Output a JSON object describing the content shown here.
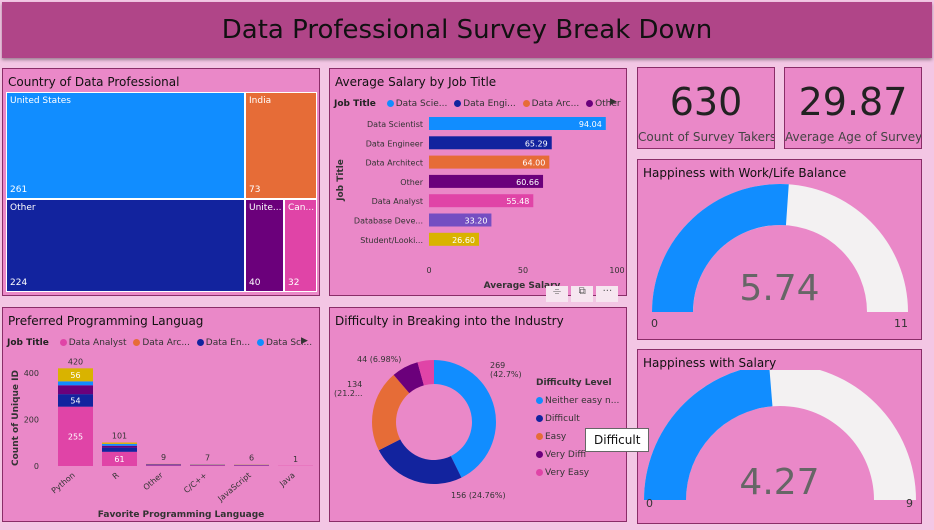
{
  "title": "Data Professional Survey Break Down",
  "country": {
    "title": "Country of Data Professional",
    "cells": [
      {
        "label": "United States",
        "value": "261",
        "color": "#118dff"
      },
      {
        "label": "India",
        "value": "73",
        "color": "#e66c37"
      },
      {
        "label": "Other",
        "value": "224",
        "color": "#12239e"
      },
      {
        "label": "Unite...",
        "value": "40",
        "color": "#6b007b"
      },
      {
        "label": "Can...",
        "value": "32",
        "color": "#e044a7"
      }
    ]
  },
  "salary": {
    "title": "Average Salary by Job Title",
    "legend_title": "Job Title",
    "legend": [
      "Data Scie...",
      "Data Engi...",
      "Data Arc...",
      "Other"
    ],
    "legend_colors": [
      "#118dff",
      "#12239e",
      "#e66c37",
      "#6b007b"
    ],
    "ylabel": "Job Title",
    "xlabel": "Average Salary",
    "ticks": [
      "0",
      "50",
      "100"
    ]
  },
  "kpi1": {
    "value": "630",
    "label": "Count of Survey Takers"
  },
  "kpi2": {
    "value": "29.87",
    "label": "Average Age of Survey ..."
  },
  "gauge1": {
    "title": "Happiness with Work/Life Balance",
    "value_label": "5.74",
    "min": "0",
    "max": "11",
    "value": 5.74,
    "maxv": 11
  },
  "gauge2": {
    "title": "Happiness with Salary",
    "value_label": "4.27",
    "min": "0",
    "max": "9",
    "value": 4.27,
    "maxv": 9
  },
  "prog": {
    "title": "Preferred Programming Languag",
    "legend_title": "Job Title",
    "legend": [
      "Data Analyst",
      "Data Arc...",
      "Data En...",
      "Data Sci..."
    ],
    "legend_colors": [
      "#e044a7",
      "#e66c37",
      "#12239e",
      "#118dff"
    ],
    "ylabel": "Count of Unique ID",
    "xlabel": "Favorite Programming Language",
    "yticks": [
      "400",
      "200",
      "0"
    ]
  },
  "difficulty": {
    "title": "Difficulty in Breaking into the Industry",
    "legend_title": "Difficulty Level",
    "legend": [
      "Neither easy n...",
      "Difficult",
      "Easy",
      "Very Diffi",
      "Very Easy"
    ],
    "legend_colors": [
      "#118dff",
      "#12239e",
      "#e66c37",
      "#6b007b",
      "#e044a7"
    ],
    "labels": [
      "269",
      "(42.7%)",
      "156 (24.76%)",
      "134",
      "(21.2...",
      "44 (6.98%)"
    ]
  },
  "tooltip": "Difficult",
  "chart_data": [
    {
      "type": "bar",
      "title": "Average Salary by Job Title",
      "xlabel": "Average Salary",
      "ylabel": "Job Title",
      "categories": [
        "Data Scientist",
        "Data Engineer",
        "Data Architect",
        "Other",
        "Data Analyst",
        "Database Deve...",
        "Student/Looki..."
      ],
      "values": [
        94.04,
        65.29,
        64.0,
        60.66,
        55.48,
        33.2,
        26.6
      ],
      "labels": [
        "94.04",
        "65.29",
        "64.00",
        "60.66",
        "55.48",
        "33.20",
        "26.60"
      ],
      "colors": [
        "#118dff",
        "#12239e",
        "#e66c37",
        "#6b007b",
        "#e044a7",
        "#744ec2",
        "#d9b300"
      ],
      "xlim": [
        0,
        100
      ]
    },
    {
      "type": "bar",
      "title": "Preferred Programming Languag",
      "xlabel": "Favorite Programming Language",
      "ylabel": "Count of Unique ID",
      "categories": [
        "Python",
        "R",
        "Other",
        "C/C++",
        "JavaScript",
        "Java"
      ],
      "totals": [
        420,
        101,
        9,
        7,
        6,
        1
      ],
      "stack_colors": [
        "#e044a7",
        "#12239e",
        "#6b007b",
        "#118dff",
        "#d9b300"
      ],
      "stacks": [
        [
          255,
          54,
          38,
          17,
          56
        ],
        [
          61,
          18,
          8,
          8,
          6
        ],
        [
          3,
          2,
          2,
          1,
          1
        ],
        [
          3,
          1,
          1,
          1,
          1
        ],
        [
          2,
          1,
          1,
          1,
          1
        ],
        [
          1,
          0,
          0,
          0,
          0
        ]
      ],
      "seg_labels": [
        [
          "255",
          "54",
          "",
          "",
          "56"
        ],
        [
          "61",
          "",
          "",
          "",
          ""
        ],
        [],
        [],
        [],
        []
      ],
      "ylim": [
        0,
        430
      ]
    },
    {
      "type": "pie",
      "title": "Difficulty in Breaking into the Industry",
      "categories": [
        "Neither easy nor difficult",
        "Difficult",
        "Easy",
        "Very Difficult",
        "Very Easy"
      ],
      "values": [
        269,
        156,
        134,
        44,
        27
      ],
      "colors": [
        "#118dff",
        "#12239e",
        "#e66c37",
        "#6b007b",
        "#e044a7"
      ]
    }
  ]
}
